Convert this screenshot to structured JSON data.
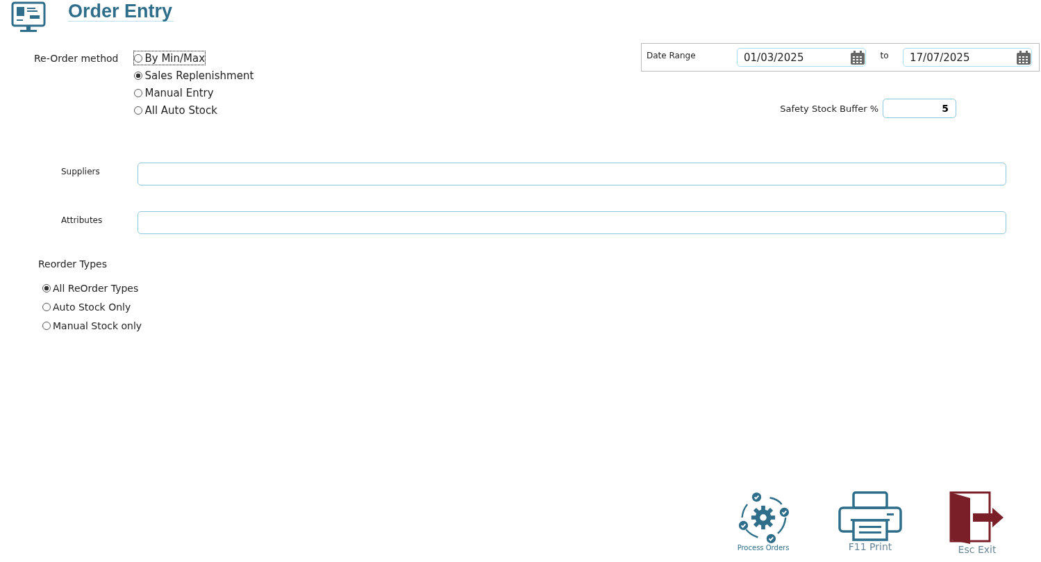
{
  "header": {
    "title": "Order Entry"
  },
  "reorder_method": {
    "label": "Re-Order method",
    "options": [
      {
        "label": "By Min/Max",
        "selected": false,
        "focused": true
      },
      {
        "label": "Sales Replenishment",
        "selected": true,
        "focused": false
      },
      {
        "label": "Manual Entry",
        "selected": false,
        "focused": false
      },
      {
        "label": "All Auto Stock",
        "selected": false,
        "focused": false
      }
    ]
  },
  "date_range": {
    "label": "Date Range",
    "from": "01/03/2025",
    "separator": "to",
    "to": "17/07/2025"
  },
  "safety_stock": {
    "label": "Safety Stock Buffer %",
    "value": "5"
  },
  "filters": [
    {
      "label": "Suppliers"
    },
    {
      "label": "Attributes"
    }
  ],
  "reorder_types": {
    "label": "Reorder Types",
    "options": [
      {
        "label": "All ReOrder Types",
        "selected": true
      },
      {
        "label": "Auto Stock Only",
        "selected": false
      },
      {
        "label": "Manual Stock only",
        "selected": false
      }
    ]
  },
  "actions": [
    {
      "kind": "process",
      "label": "Process Orders"
    },
    {
      "kind": "print",
      "label": "F11 Print"
    },
    {
      "kind": "exit",
      "label": "Esc Exit"
    }
  ]
}
